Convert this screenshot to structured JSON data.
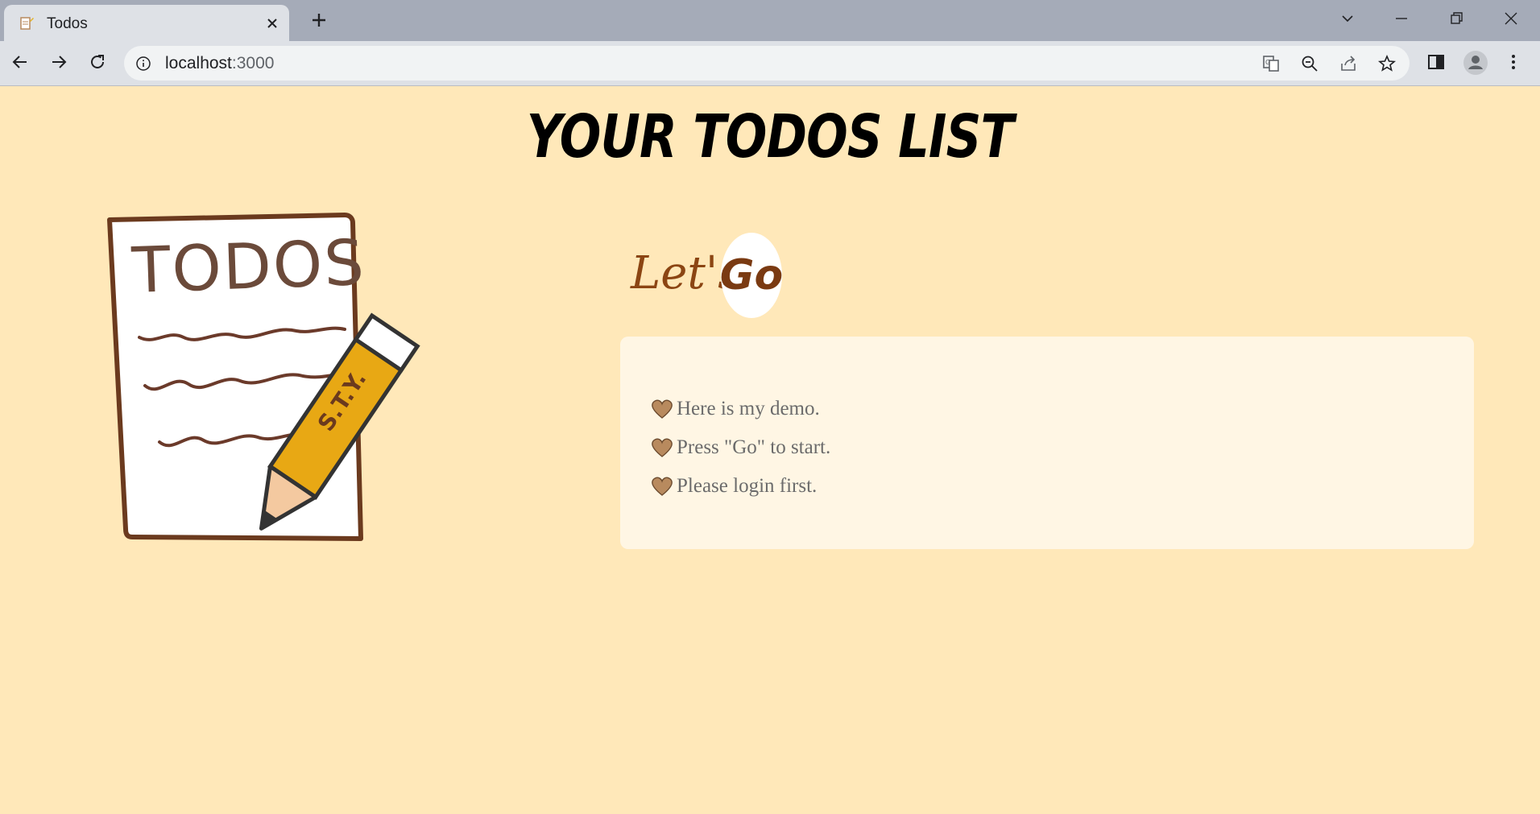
{
  "browser": {
    "tab_title": "Todos",
    "url_host": "localhost",
    "url_port": ":3000"
  },
  "page": {
    "title": "YOUR TODOS LIST",
    "lets_label": "Let's",
    "go_label": "Go",
    "notes": [
      "Here is my demo.",
      "Press \"Go\" to start.",
      "Please login first."
    ],
    "illustration_text": "TODOS",
    "pencil_text": "S.T.Y."
  },
  "colors": {
    "page_bg": "#ffe8b9",
    "card_bg": "#fff6e4",
    "accent_brown": "#8b4513",
    "heart": "#b88a5e"
  },
  "icons": {
    "heart": "heart-icon"
  }
}
